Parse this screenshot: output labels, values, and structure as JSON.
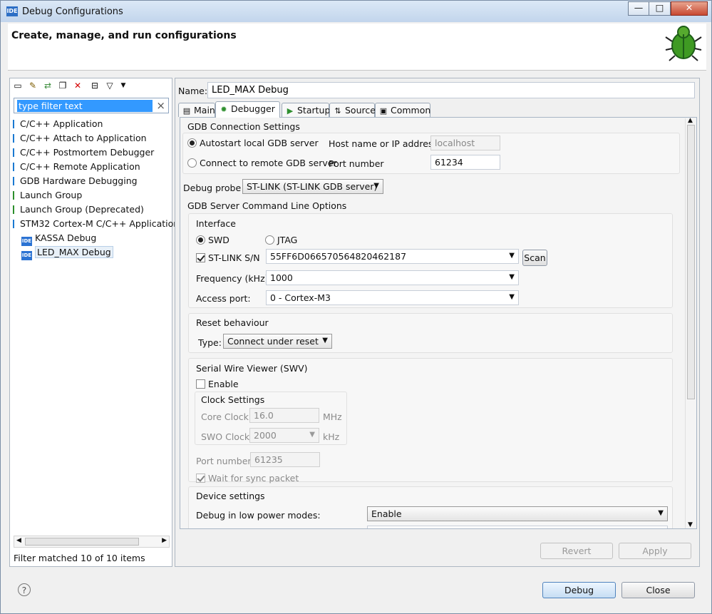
{
  "window": {
    "title": "Debug Configurations",
    "header_title": "Create, manage, and run configurations"
  },
  "left": {
    "filter_value": "type filter text",
    "items": [
      {
        "label": "C/C++ Application"
      },
      {
        "label": "C/C++ Attach to Application"
      },
      {
        "label": "C/C++ Postmortem Debugger"
      },
      {
        "label": "C/C++ Remote Application"
      },
      {
        "label": "GDB Hardware Debugging"
      },
      {
        "label": "Launch Group"
      },
      {
        "label": "Launch Group (Deprecated)"
      },
      {
        "label": "STM32 Cortex-M C/C++ Application"
      },
      {
        "label": "KASSA Debug"
      },
      {
        "label": "LED_MAX Debug"
      }
    ],
    "status": "Filter matched 10 of 10 items"
  },
  "right": {
    "name_label": "Name:",
    "name_value": "LED_MAX Debug",
    "tabs": [
      {
        "label": "Main"
      },
      {
        "label": "Debugger"
      },
      {
        "label": "Startup"
      },
      {
        "label": "Source"
      },
      {
        "label": "Common"
      }
    ],
    "gdb": {
      "section": "GDB Connection Settings",
      "autostart": "Autostart local GDB server",
      "remote": "Connect to remote GDB server",
      "host_label": "Host name or IP address",
      "host_value": "localhost",
      "port_label": "Port number",
      "port_value": "61234"
    },
    "probe": {
      "label": "Debug probe",
      "value": "ST-LINK (ST-LINK GDB server)"
    },
    "cmd": {
      "section": "GDB Server Command Line Options"
    },
    "interface": {
      "title": "Interface",
      "swd": "SWD",
      "jtag": "JTAG",
      "stlink_label": "ST-LINK S/N",
      "stlink_value": "55FF6D066570564820462187",
      "scan": "Scan",
      "freq_label": "Frequency (kHz):",
      "freq_value": "1000",
      "access_label": "Access port:",
      "access_value": "0 - Cortex-M3"
    },
    "reset": {
      "title": "Reset behaviour",
      "type_label": "Type:",
      "type_value": "Connect under reset"
    },
    "swv": {
      "title": "Serial Wire Viewer (SWV)",
      "enable": "Enable",
      "clock_title": "Clock Settings",
      "core_label": "Core Clock:",
      "core_value": "16.0",
      "core_unit": "MHz",
      "swo_label": "SWO Clock:",
      "swo_value": "2000",
      "swo_unit": "kHz",
      "port_label": "Port number:",
      "port_value": "61235",
      "wait": "Wait for sync packet"
    },
    "device": {
      "title": "Device settings",
      "low_power_label": "Debug in low power modes:",
      "low_power_value": "Enable"
    },
    "buttons": {
      "revert": "Revert",
      "apply": "Apply"
    }
  },
  "footer": {
    "help": "?",
    "debug": "Debug",
    "close": "Close"
  }
}
